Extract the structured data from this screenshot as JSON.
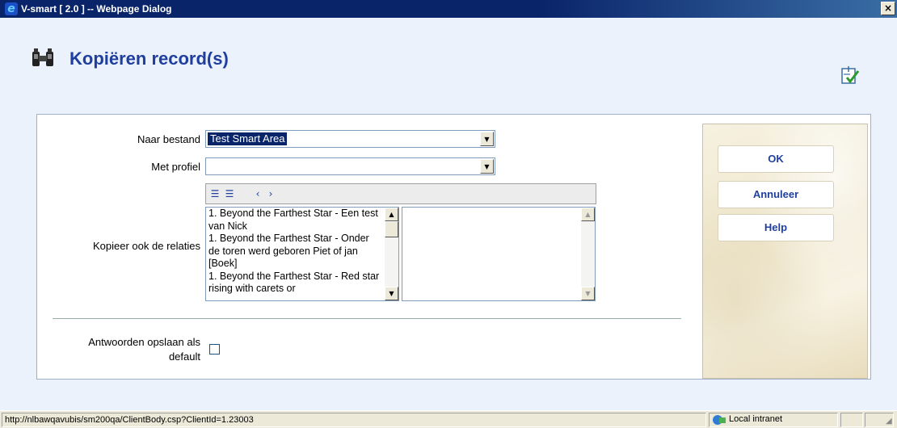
{
  "window": {
    "title": "V-smart [ 2.0 ] -- Webpage Dialog",
    "close_label": "×"
  },
  "page": {
    "title": "Kopiëren record(s)"
  },
  "form": {
    "naar_bestand": {
      "label": "Naar bestand",
      "value": "Test Smart Area"
    },
    "met_profiel": {
      "label": "Met profiel",
      "value": ""
    },
    "relaties": {
      "label": "Kopieer ook de relaties",
      "items": [
        "1. Beyond the Farthest Star - Een test van Nick",
        "1. Beyond the Farthest Star - Onder de toren werd geboren Piet of jan [Boek]",
        "1. Beyond the Farthest Star - Red star rising with carets or"
      ]
    },
    "default": {
      "label_line1": "Antwoorden opslaan als",
      "label_line2": "default",
      "checked": false
    }
  },
  "buttons": {
    "ok": "OK",
    "annuleer": "Annuleer",
    "help": "Help"
  },
  "statusbar": {
    "url": "http://nlbawqavubis/sm200qa/ClientBody.csp?ClientId=1.23003",
    "zone": "Local intranet"
  },
  "icons": {
    "title_icon": "ie-icon",
    "heading_icon": "binoculars-icon",
    "corner_icon": "checklist-icon"
  }
}
